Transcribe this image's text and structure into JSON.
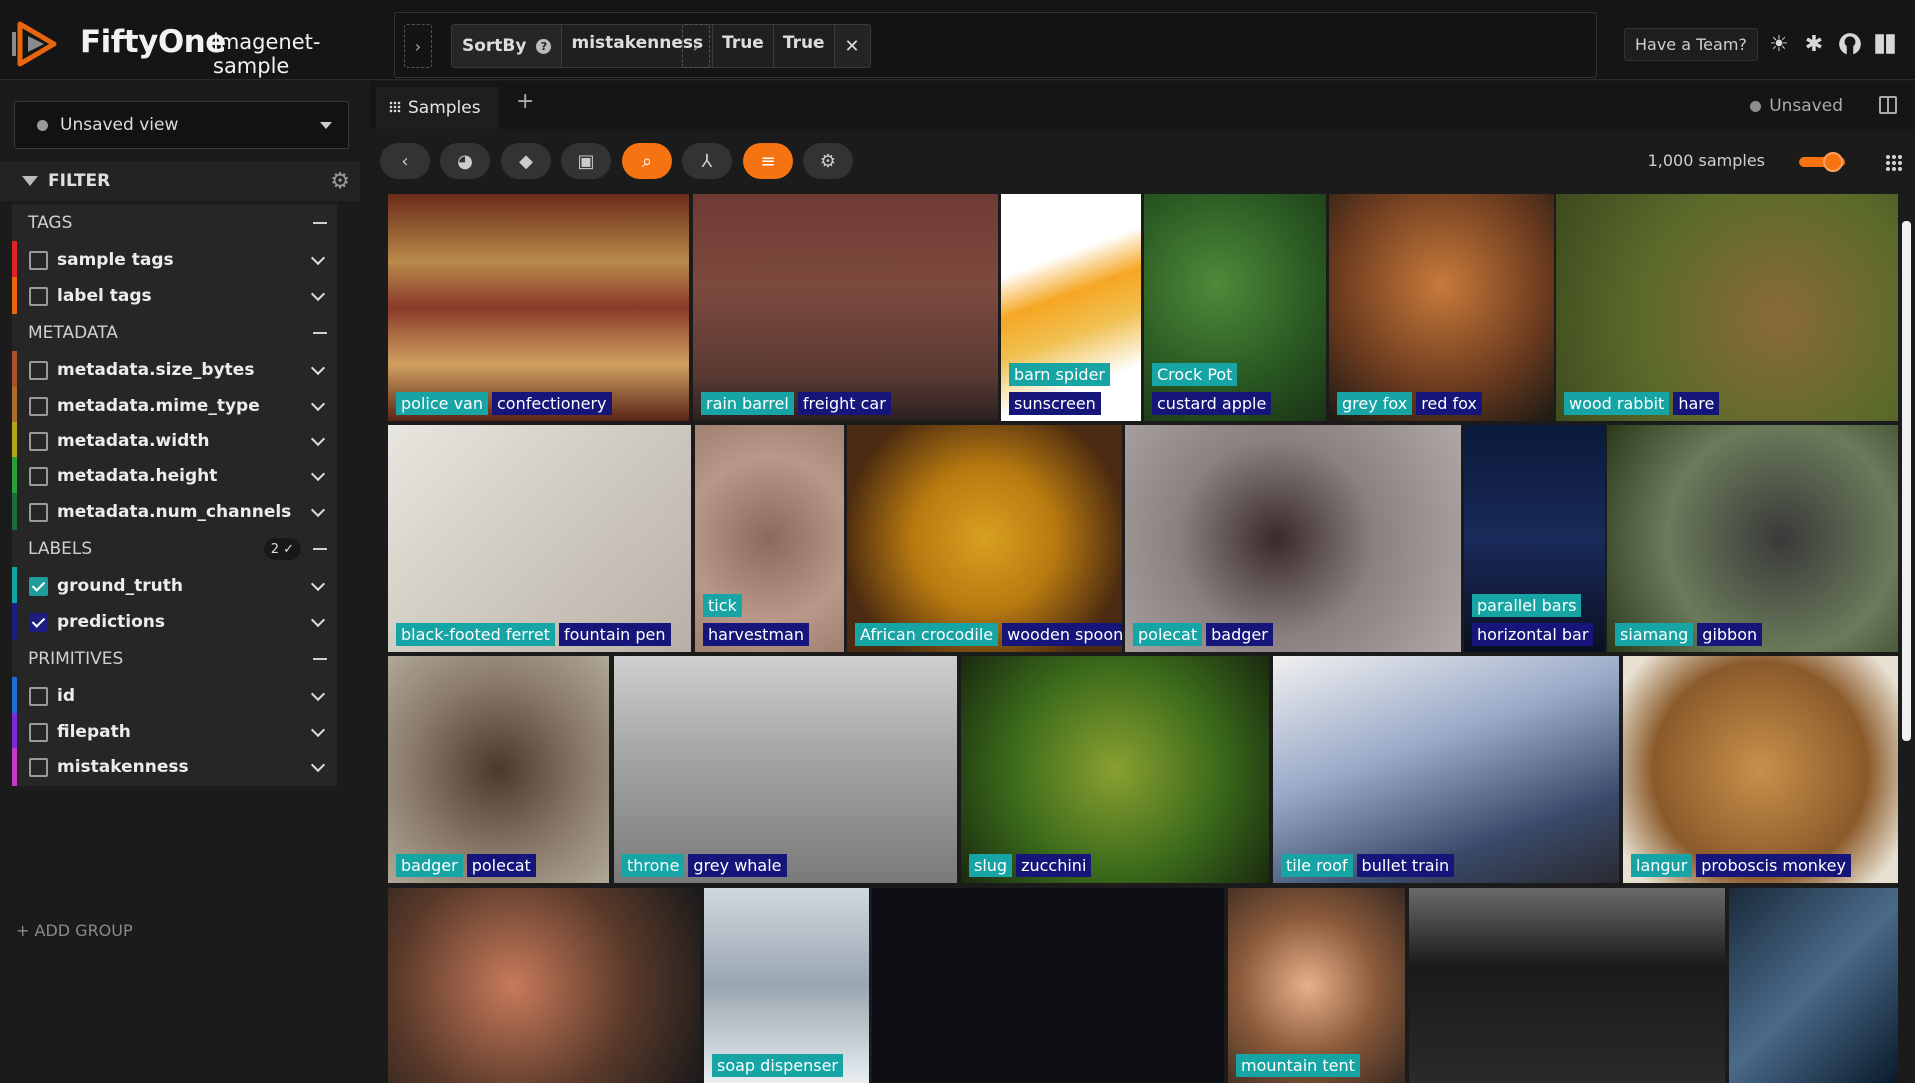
{
  "header": {
    "brand": "FiftyOne",
    "dataset": "imagenet-sample",
    "stage_name": "SortBy",
    "stage_params": [
      "mistakenness",
      "True",
      "True"
    ],
    "team_button": "Have a Team?",
    "icons": [
      "sun-icon",
      "slack-icon",
      "github-icon",
      "book-icon"
    ]
  },
  "sidebar": {
    "view_select": "Unsaved view",
    "filter_title": "FILTER",
    "groups": {
      "tags": "TAGS",
      "metadata": "METADATA",
      "labels": "LABELS",
      "labels_badge": "2 ✓",
      "primitives": "PRIMITIVES"
    },
    "fields": {
      "sample_tags": "sample tags",
      "label_tags": "label tags",
      "size_bytes": "metadata.size_bytes",
      "mime_type": "metadata.mime_type",
      "width": "metadata.width",
      "height": "metadata.height",
      "num_channels": "metadata.num_channels",
      "ground_truth": "ground_truth",
      "predictions": "predictions",
      "id": "id",
      "filepath": "filepath",
      "mistakenness": "mistakenness"
    },
    "field_colors": {
      "sample_tags": "#e0242a",
      "label_tags": "#e8660f",
      "size_bytes": "#a8532b",
      "mime_type": "#a86d2b",
      "width": "#b2a41c",
      "height": "#27a03a",
      "num_channels": "#1e6c3a",
      "ground_truth": "#17a4a4",
      "predictions": "#1d1d7f",
      "id": "#1f6ed4",
      "filepath": "#7a2bd4",
      "mistakenness": "#c23ac8"
    },
    "add_group": "+ ADD GROUP"
  },
  "main": {
    "tab_label": "Samples",
    "tab_add": "+",
    "unsaved": "Unsaved",
    "sample_count": "1,000 samples"
  },
  "tiles": [
    {
      "gt": "police van",
      "pr": "confectionery"
    },
    {
      "gt": "rain barrel",
      "pr": "freight car"
    },
    {
      "gt": "barn spider",
      "pr": "sunscreen"
    },
    {
      "gt": "Crock Pot",
      "pr": "custard apple"
    },
    {
      "gt": "grey fox",
      "pr": "red fox"
    },
    {
      "gt": "wood rabbit",
      "pr": "hare"
    },
    {
      "gt": "black-footed ferret",
      "pr": "fountain pen"
    },
    {
      "gt": "tick",
      "pr": "harvestman"
    },
    {
      "gt": "African crocodile",
      "pr": "wooden spoon"
    },
    {
      "gt": "polecat",
      "pr": "badger"
    },
    {
      "gt": "parallel bars",
      "pr": "horizontal bar"
    },
    {
      "gt": "siamang",
      "pr": "gibbon"
    },
    {
      "gt": "badger",
      "pr": "polecat"
    },
    {
      "gt": "throne",
      "pr": "grey whale"
    },
    {
      "gt": "slug",
      "pr": "zucchini"
    },
    {
      "gt": "tile roof",
      "pr": "bullet train"
    },
    {
      "gt": "langur",
      "pr": "proboscis monkey"
    },
    {
      "gt": "",
      "pr": ""
    },
    {
      "gt": "soap dispenser",
      "pr": ""
    },
    {
      "gt": "",
      "pr": ""
    },
    {
      "gt": "mountain tent",
      "pr": ""
    },
    {
      "gt": "",
      "pr": ""
    },
    {
      "gt": "",
      "pr": ""
    }
  ],
  "colors": {
    "accent": "#f57411",
    "ground_truth_label": "#17a4a4",
    "predictions_label": "#15157a"
  }
}
